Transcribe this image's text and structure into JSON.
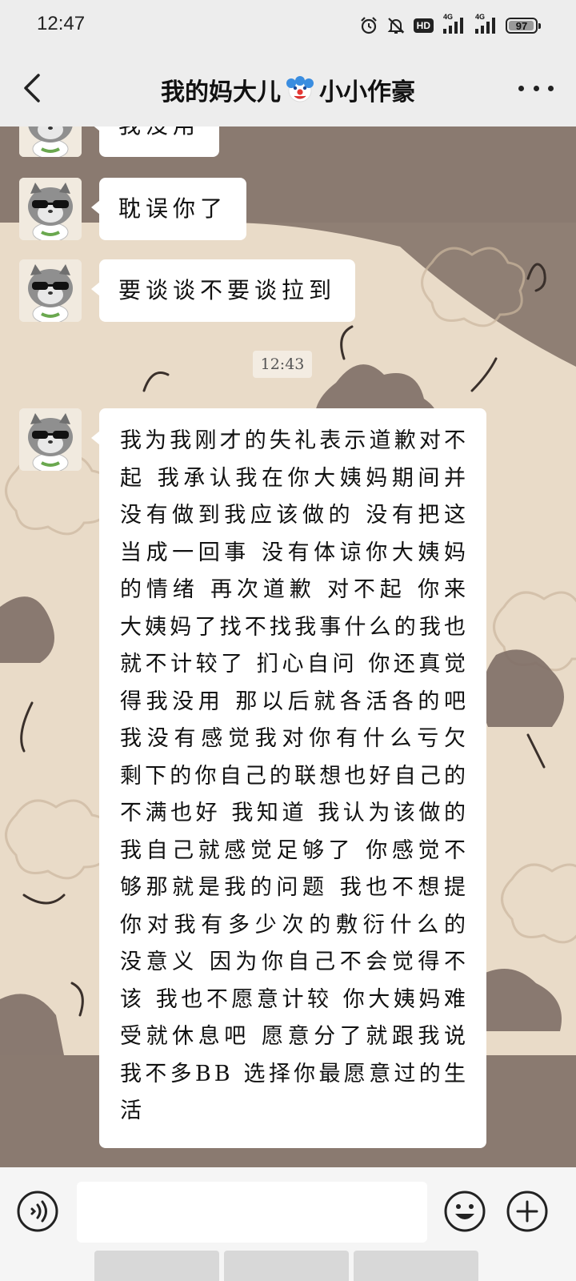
{
  "status_bar": {
    "time": "12:47",
    "hd_label": "HD",
    "network_1": "4G",
    "network_2": "4G",
    "battery": "97",
    "battery_level": 0.97,
    "icons": [
      "alarm-icon",
      "mute-icon",
      "hd-icon",
      "signal-icon",
      "signal-icon",
      "battery-icon"
    ]
  },
  "header": {
    "title_left": "我的妈大儿",
    "title_right": "小小作豪",
    "title_emoji": "clown-face-icon",
    "back_icon": "chevron-left-icon",
    "more_icon": "more-dots-icon"
  },
  "messages": [
    {
      "text": "我没用"
    },
    {
      "text": "耽误你了"
    },
    {
      "text": "要谈谈不要谈拉到"
    }
  ],
  "timestamp": "12:43",
  "long_message": {
    "text": "我为我刚才的失礼表示道歉对不起 我承认我在你大姨妈期间并没有做到我应该做的 没有把这当成一回事 没有体谅你大姨妈的情绪 再次道歉 对不起 你来大姨妈了找不找我事什么的我也就不计较了 扪心自问 你还真觉得我没用 那以后就各活各的吧 我没有感觉我对你有什么亏欠 剩下的你自己的联想也好自己的不满也好 我知道 我认为该做的我自己就感觉足够了 你感觉不够那就是我的问题 我也不想提你对我有多少次的敷衍什么的 没意义 因为你自己不会觉得不该 我也不愿意计较 你大姨妈难受就休息吧 愿意分了就跟我说 我不多BB 选择你最愿意过的生活"
  },
  "input_bar": {
    "placeholder": "",
    "voice_icon": "voice-icon",
    "emoji_icon": "emoji-icon",
    "plus_icon": "plus-icon"
  },
  "colors": {
    "header_bg": "#ededed",
    "wallpaper_bg": "#e6d7c3",
    "bubble_bg": "#ffffff",
    "wallpaper_dark": "#8a7a70"
  }
}
